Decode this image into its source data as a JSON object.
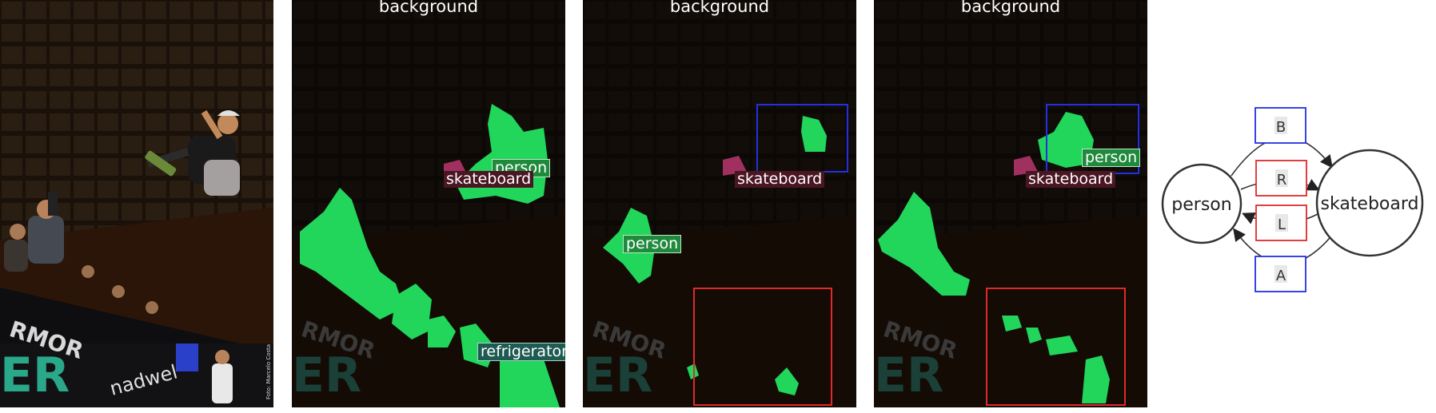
{
  "photo_credit": "Foto: Marcelo Costa",
  "panels": {
    "p2": {
      "top_label": "background",
      "tags": [
        "person",
        "skateboard",
        "refrigerator"
      ]
    },
    "p3": {
      "top_label": "background",
      "tags": [
        "person",
        "skateboard"
      ]
    },
    "p4": {
      "top_label": "background",
      "tags": [
        "person",
        "skateboard"
      ]
    }
  },
  "graph": {
    "node_left": "person",
    "node_right": "skateboard",
    "edges": [
      {
        "label": "B",
        "color": "#2430e0"
      },
      {
        "label": "R",
        "color": "#e02a2a"
      },
      {
        "label": "L",
        "color": "#e02a2a"
      },
      {
        "label": "A",
        "color": "#2430e0"
      }
    ]
  },
  "colors": {
    "mask": "#21d65a",
    "blue_box": "#2430e0",
    "red_box": "#e02a2a"
  }
}
